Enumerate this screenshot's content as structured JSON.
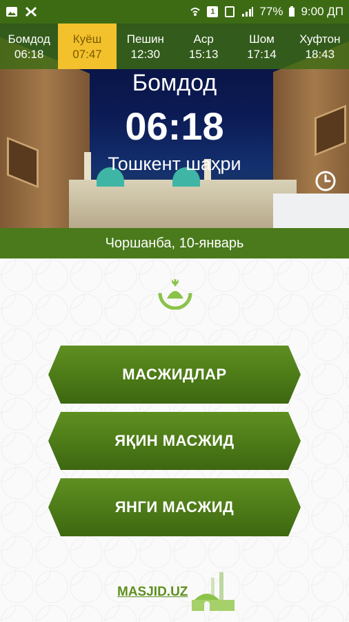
{
  "status_bar": {
    "battery": "77%",
    "time": "9:00 ДП",
    "sim_badge": "1"
  },
  "prayer_times": [
    {
      "name": "Бомдод",
      "time": "06:18",
      "active": false
    },
    {
      "name": "Куёш",
      "time": "07:47",
      "active": true
    },
    {
      "name": "Пешин",
      "time": "12:30",
      "active": false
    },
    {
      "name": "Аср",
      "time": "15:13",
      "active": false
    },
    {
      "name": "Шом",
      "time": "17:14",
      "active": false
    },
    {
      "name": "Хуфтон",
      "time": "18:43",
      "active": false
    }
  ],
  "current": {
    "prayer": "Бомдод",
    "time": "06:18",
    "city": "Тошкент шаҳри"
  },
  "date": "Чоршанба, 10-январь",
  "menu": {
    "mosques": "МАСЖИДЛАР",
    "nearest": "ЯҚИН МАСЖИД",
    "new": "ЯНГИ МАСЖИД"
  },
  "brand": "MASJID.UZ",
  "colors": {
    "primary_green": "#4a7a1b",
    "active_tab": "#f3c12b",
    "accent_green": "#8bc34a"
  }
}
